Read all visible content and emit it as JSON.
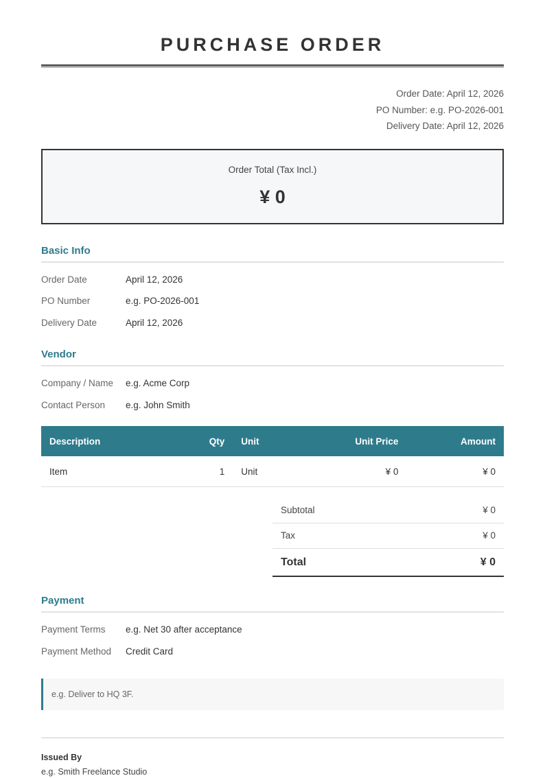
{
  "document": {
    "title": "PURCHASE ORDER"
  },
  "meta": {
    "order_date": "Order Date: April 12, 2026",
    "po_number": "PO Number: e.g. PO-2026-001",
    "delivery_date": "Delivery Date: April 12, 2026"
  },
  "order_total": {
    "label": "Order Total (Tax Incl.)",
    "value": "¥ 0"
  },
  "basic_info": {
    "title": "Basic Info",
    "rows": [
      {
        "label": "Order Date",
        "value": "April 12, 2026"
      },
      {
        "label": "PO Number",
        "value": "e.g. PO-2026-001"
      },
      {
        "label": "Delivery Date",
        "value": "April 12, 2026"
      }
    ]
  },
  "vendor": {
    "title": "Vendor",
    "rows": [
      {
        "label": "Company / Name",
        "value": "e.g. Acme Corp"
      },
      {
        "label": "Contact Person",
        "value": "e.g. John Smith"
      }
    ]
  },
  "items_table": {
    "headers": {
      "description": "Description",
      "qty": "Qty",
      "unit": "Unit",
      "unit_price": "Unit Price",
      "amount": "Amount"
    },
    "rows": [
      {
        "description": "Item",
        "qty": "1",
        "unit": "Unit",
        "unit_price": "¥ 0",
        "amount": "¥ 0"
      }
    ]
  },
  "summary": {
    "subtotal_label": "Subtotal",
    "subtotal_value": "¥ 0",
    "tax_label": "Tax",
    "tax_value": "¥ 0",
    "total_label": "Total",
    "total_value": "¥ 0"
  },
  "payment": {
    "title": "Payment",
    "rows": [
      {
        "label": "Payment Terms",
        "value": "e.g. Net 30 after acceptance"
      },
      {
        "label": "Payment Method",
        "value": "Credit Card"
      }
    ]
  },
  "notes": {
    "text": "e.g. Deliver to HQ 3F."
  },
  "issuer": {
    "label": "Issued By",
    "value": "e.g. Smith Freelance Studio"
  },
  "colors": {
    "accent": "#2e7b8c",
    "text": "#333333"
  }
}
